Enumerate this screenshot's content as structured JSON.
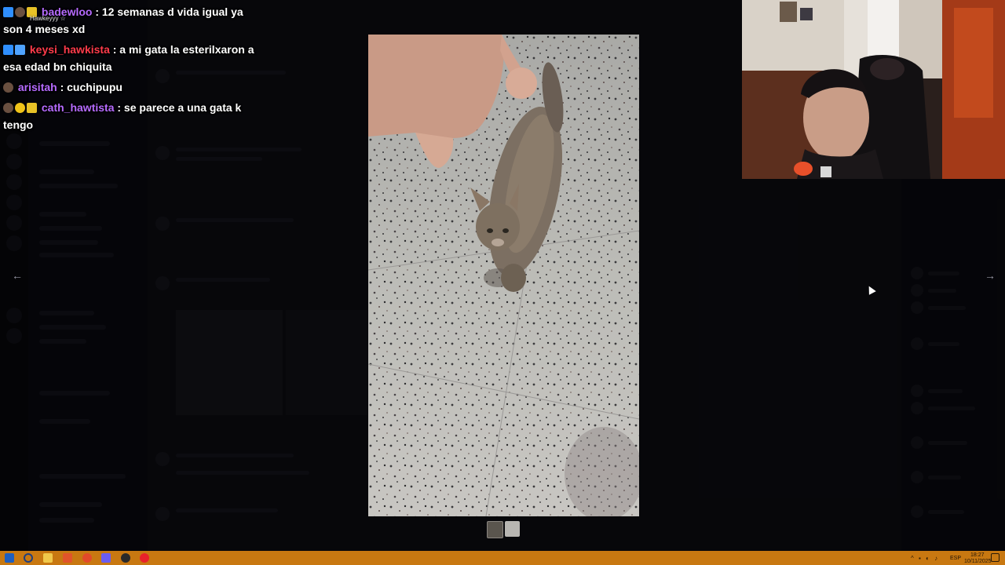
{
  "chat_overlay": {
    "sub_tag": "Hawkeyyy ☆",
    "messages": [
      {
        "user": "badewloo",
        "text": " : 12 semanas d vida igual ya son 4 meses xd"
      },
      {
        "user": "keysi_hawkista",
        "text": " : a mi gata la esterilxaron a esa edad bn chiquita"
      },
      {
        "user": "arisitah",
        "text": " : cuchipupu"
      },
      {
        "user": "cath_hawtista",
        "text": " : se parece a una gata k tengo"
      }
    ]
  },
  "viewer": {
    "prev_arrow": "←",
    "next_arrow": "→",
    "thumbnail_count": 2
  },
  "taskbar": {
    "language": "ESP",
    "time": "18:27",
    "date": "10/11/2025",
    "colors": {
      "bar": "#c87811"
    }
  },
  "colors": {
    "nick_purple": "#b66bff",
    "nick_red": "#ff3b4b"
  }
}
